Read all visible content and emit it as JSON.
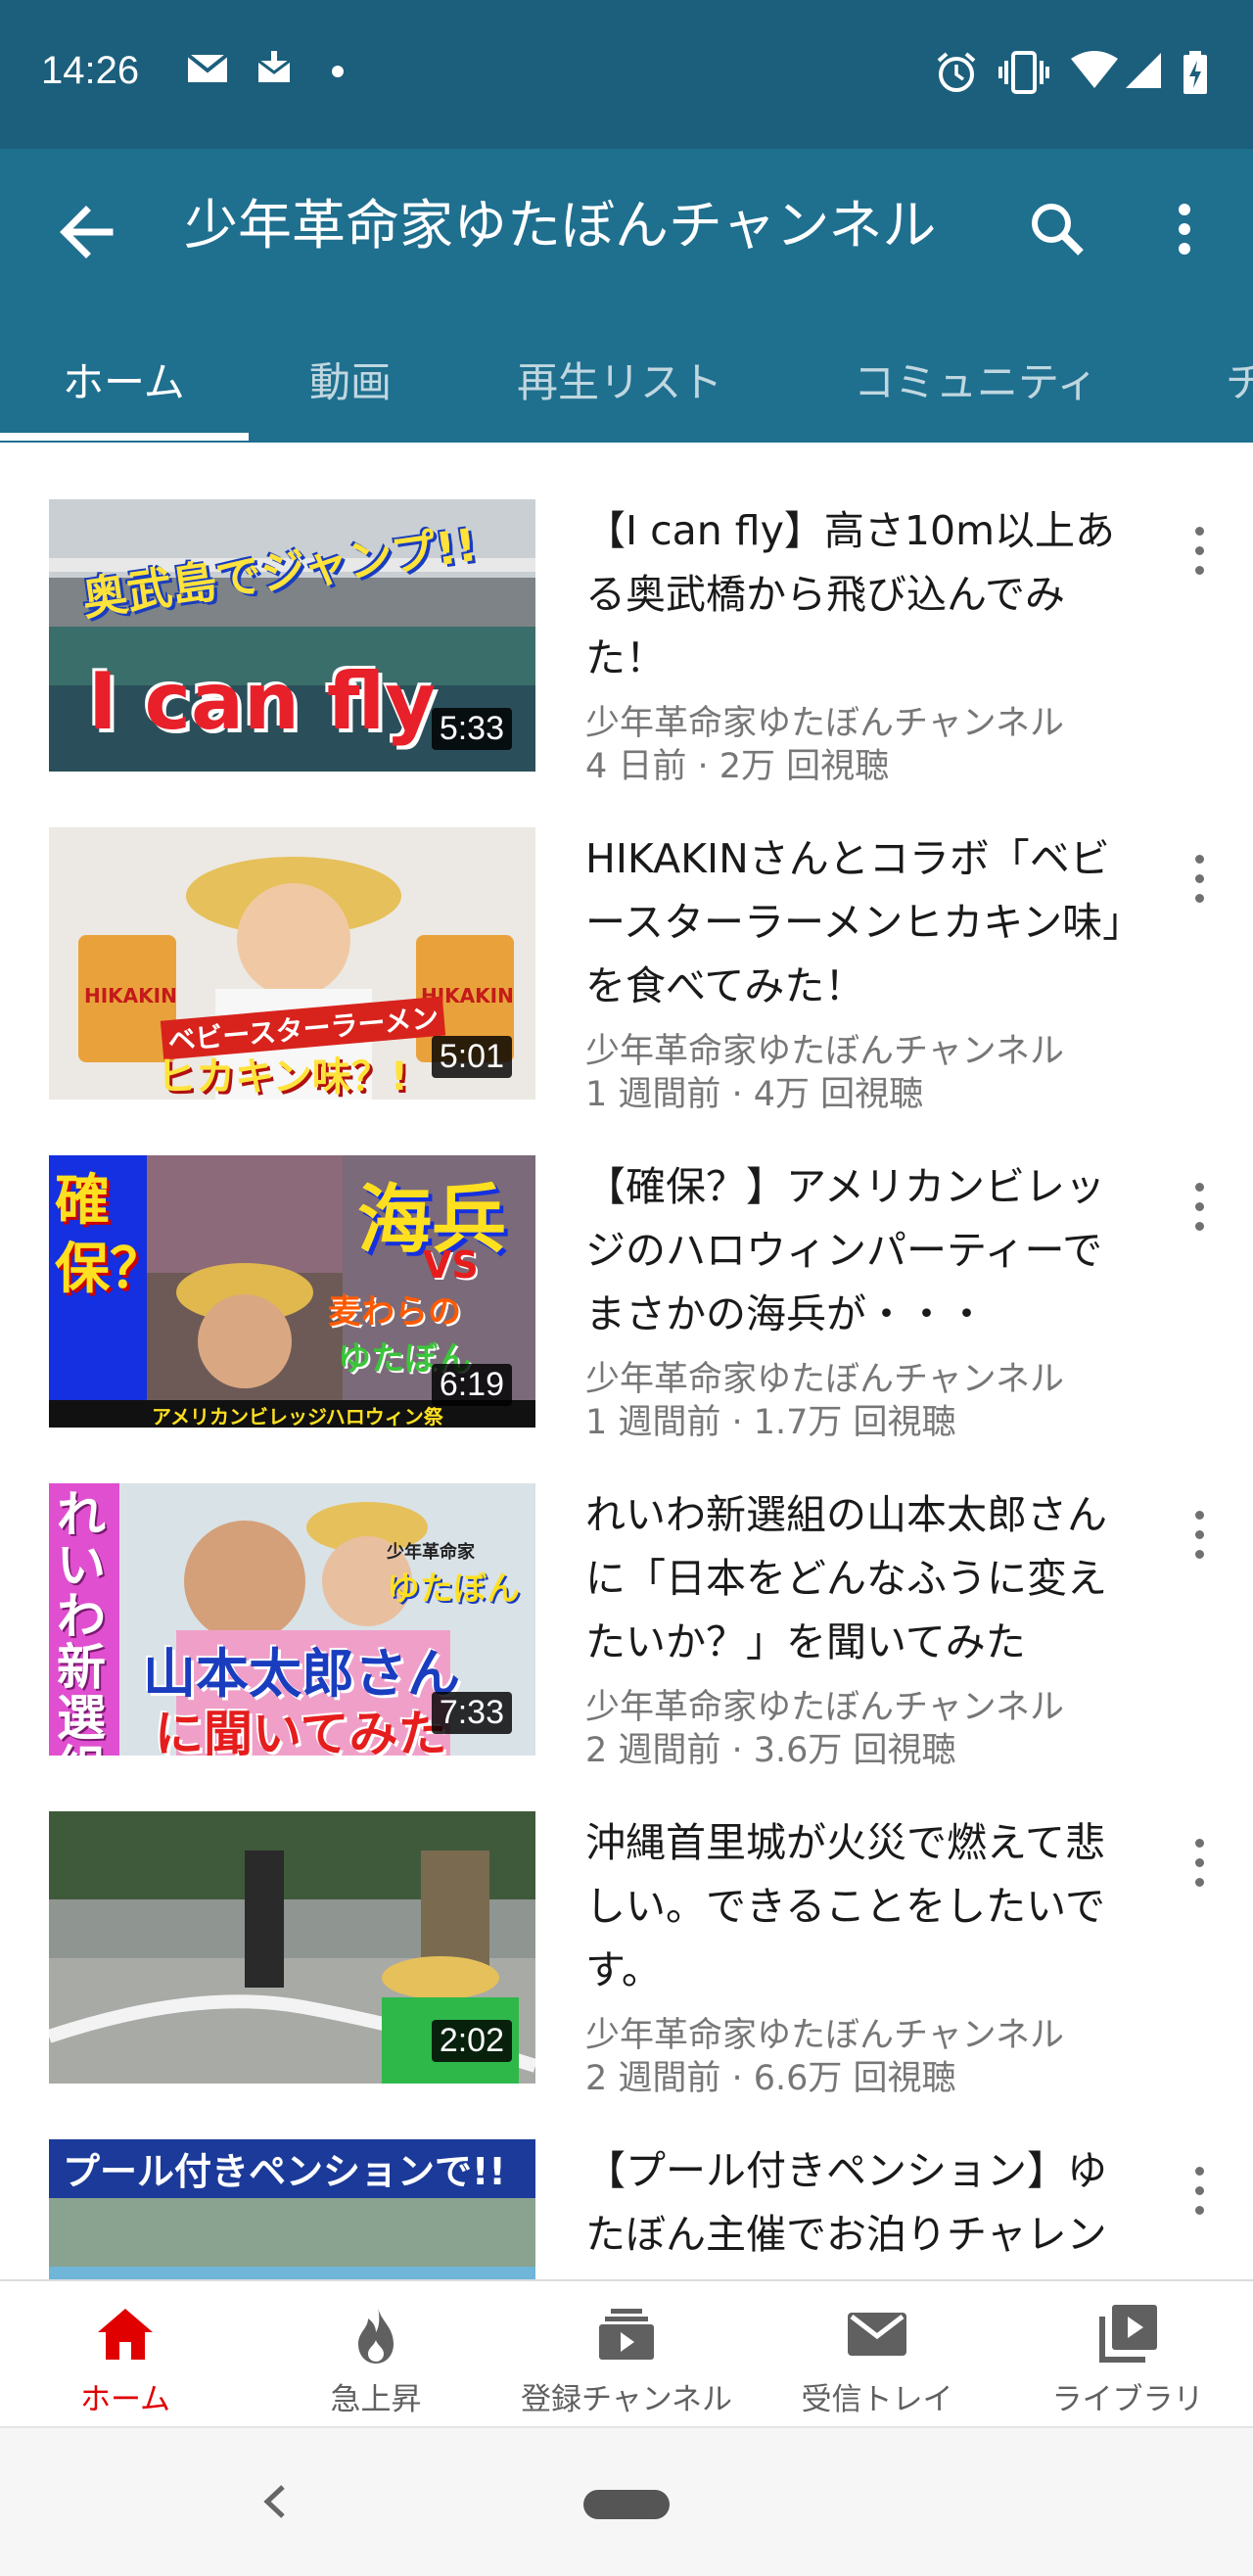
{
  "status_bar": {
    "time": "14:26",
    "left_icons": [
      "mail-icon",
      "mail-download-icon",
      "dot-icon"
    ],
    "right_icons": [
      "alarm-icon",
      "vibrate-icon",
      "wifi-icon",
      "signal-icon",
      "battery-charging-icon"
    ]
  },
  "app_bar": {
    "back_icon": "arrow-back-icon",
    "title": "少年革命家ゆたぼんチャンネル",
    "search_icon": "search-icon",
    "more_icon": "more-vert-icon",
    "background": "#1f6f8f"
  },
  "tabs": [
    {
      "label": "ホーム",
      "active": true
    },
    {
      "label": "動画",
      "active": false
    },
    {
      "label": "再生リスト",
      "active": false
    },
    {
      "label": "コミュニティ",
      "active": false
    },
    {
      "label": "チ",
      "active": false
    }
  ],
  "videos": [
    {
      "title": "【I can fly】高さ10m以上ある奥武橋から飛び込んでみた！",
      "channel": "少年革命家ゆたぼんチャンネル",
      "meta": "4 日前 · 2万 回視聴",
      "duration": "5:33",
      "thumb_text_1": "奥武島でジャンプ!!",
      "thumb_text_2": "I can fly"
    },
    {
      "title": "HIKAKINさんとコラボ「ベビースターラーメンヒカキン味」を食べてみた！",
      "channel": "少年革命家ゆたぼんチャンネル",
      "meta": "1 週間前 · 4万 回視聴",
      "duration": "5:01",
      "thumb_text_1": "ベビースターラーメン",
      "thumb_text_2": "ヒカキン味？!",
      "thumb_text_3": "HIKAKIN"
    },
    {
      "title": "【確保？】アメリカンビレッジのハロウィンパーティーでまさかの海兵が・・・",
      "channel": "少年革命家ゆたぼんチャンネル",
      "meta": "1 週間前 · 1.7万 回視聴",
      "duration": "6:19",
      "thumb_text_1": "確保？",
      "thumb_text_2": "海兵",
      "thumb_text_3": "VS",
      "thumb_text_4": "麦わらの",
      "thumb_text_5": "ゆたぼん",
      "thumb_text_6": "アメリカンビレッジハロウィン祭"
    },
    {
      "title": "れいわ新選組の山本太郎さんに「日本をどんなふうに変えたいか？」を聞いてみた",
      "channel": "少年革命家ゆたぼんチャンネル",
      "meta": "2 週間前 · 3.6万 回視聴",
      "duration": "7:33",
      "thumb_text_1": "れいわ新選組",
      "thumb_text_2": "山本太郎さん",
      "thumb_text_3": "に聞いてみた",
      "thumb_text_4": "少年革命家",
      "thumb_text_5": "ゆたぼん"
    },
    {
      "title": "沖縄首里城が火災で燃えて悲しい。できることをしたいです。",
      "channel": "少年革命家ゆたぼんチャンネル",
      "meta": "2 週間前 · 6.6万 回視聴",
      "duration": "2:02"
    },
    {
      "title": "【プール付きペンション】ゆたぼん主催でお泊りチャレンジ",
      "channel": "",
      "meta": "",
      "duration": "",
      "thumb_text_1": "プール付きペンションで!!"
    }
  ],
  "bottom_nav": [
    {
      "label": "ホーム",
      "icon": "home-icon",
      "active": true
    },
    {
      "label": "急上昇",
      "icon": "trending-flame-icon",
      "active": false
    },
    {
      "label": "登録チャンネル",
      "icon": "subscriptions-icon",
      "active": false
    },
    {
      "label": "受信トレイ",
      "icon": "inbox-mail-icon",
      "active": false
    },
    {
      "label": "ライブラリ",
      "icon": "library-icon",
      "active": false
    }
  ],
  "system_nav": {
    "back_icon": "chevron-left-icon",
    "home_icon": "home-pill-icon"
  },
  "colors": {
    "header": "#1f6f8f",
    "status_bar": "#1b5f7c",
    "accent_red": "#e00000"
  }
}
